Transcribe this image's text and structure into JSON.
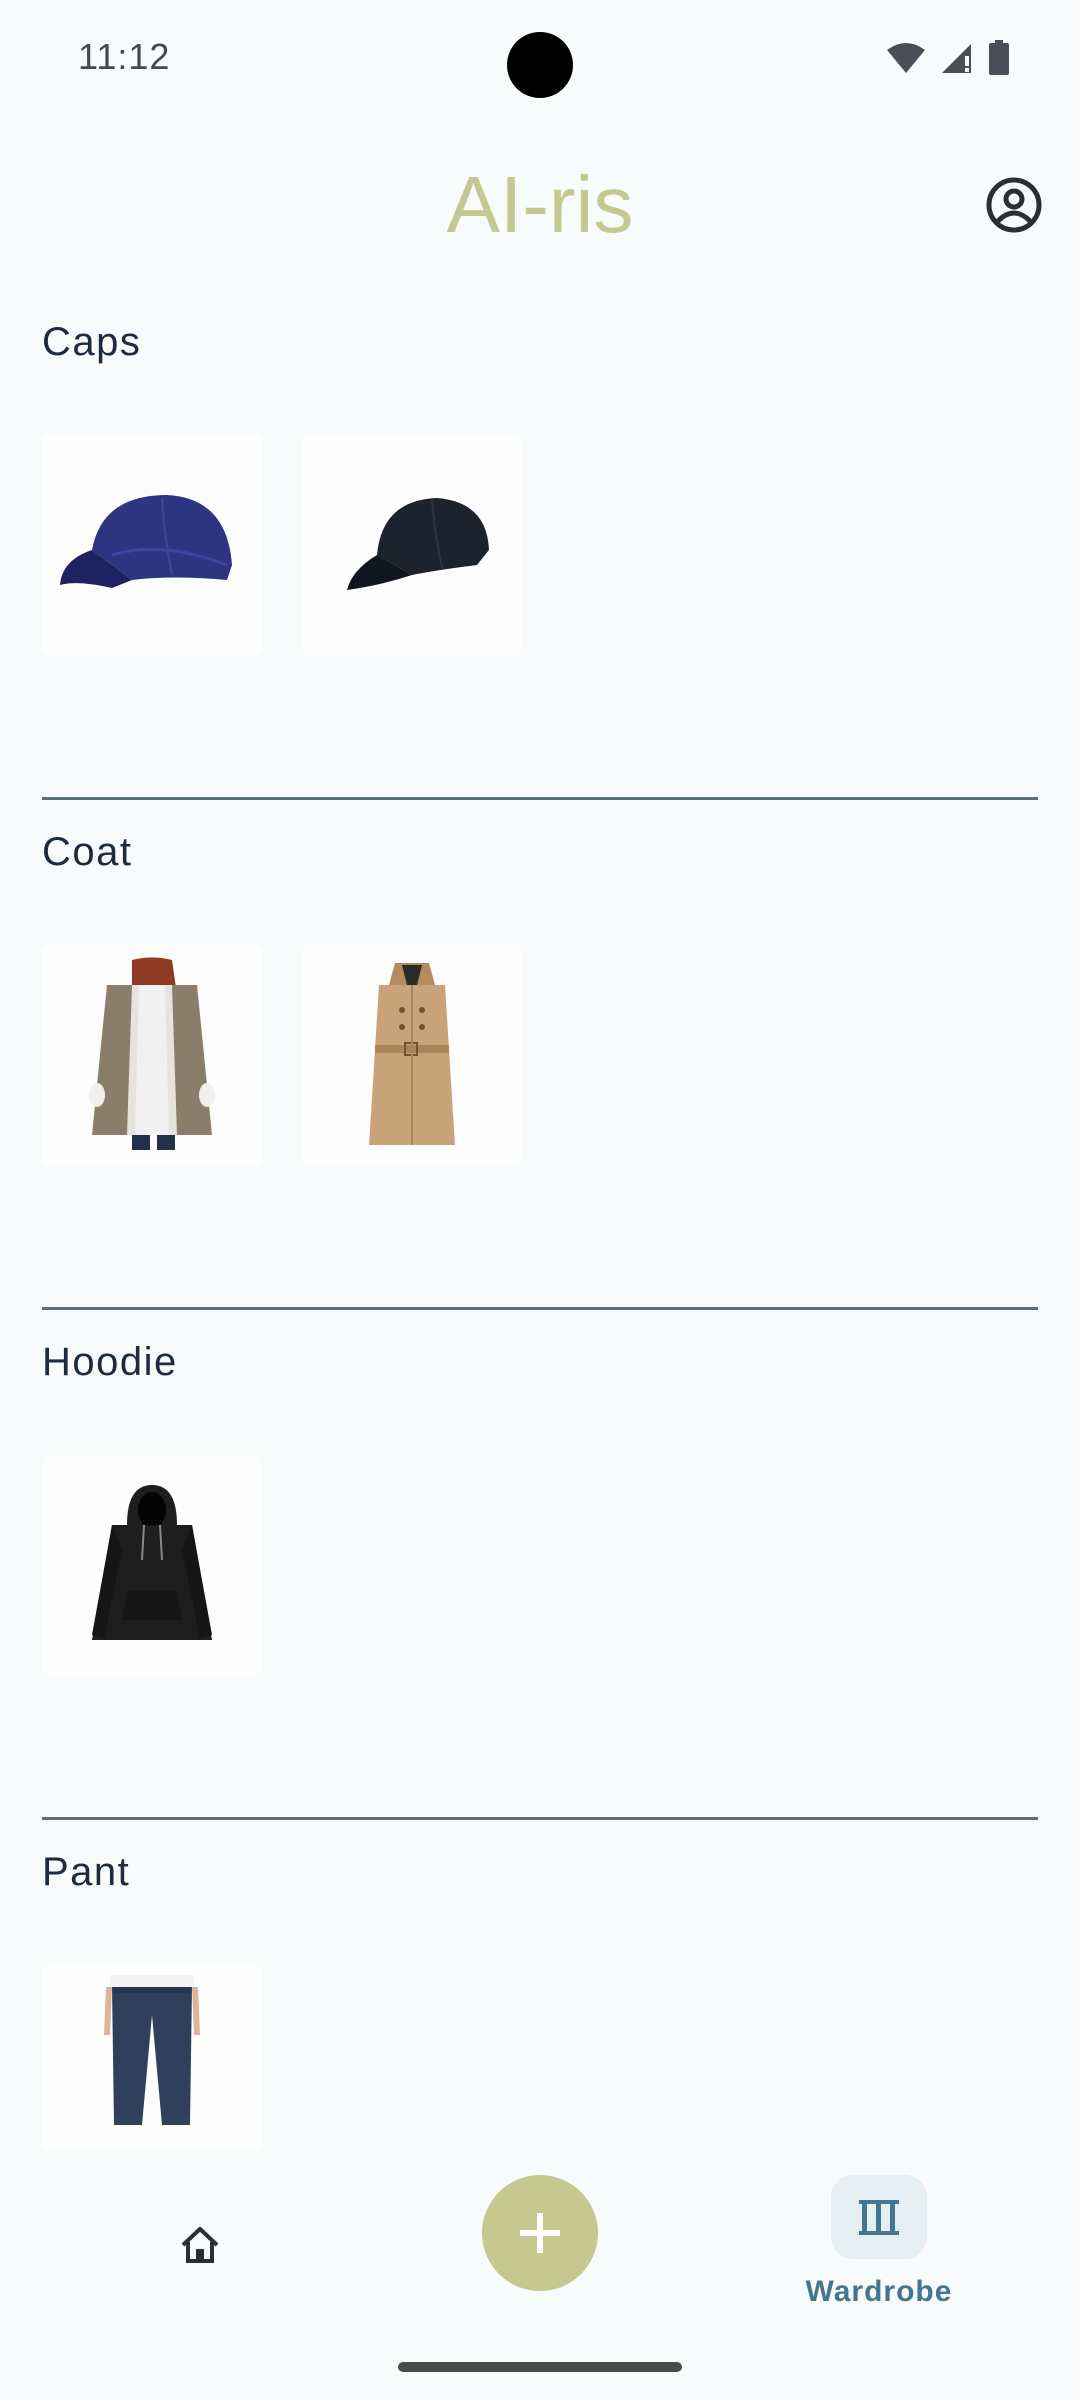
{
  "status_bar": {
    "time": "11:12",
    "icons": [
      "wifi-icon",
      "signal-icon",
      "battery-icon"
    ]
  },
  "app_bar": {
    "title": "AI-ris",
    "title_color": "#c5c98f",
    "profile_icon": "account-circle-icon"
  },
  "wardrobe": {
    "categories": [
      {
        "title": "Caps",
        "items": [
          "navy-cap-image",
          "black-cap-image"
        ]
      },
      {
        "title": "Coat",
        "items": [
          "shearling-coat-image",
          "trench-coat-image"
        ]
      },
      {
        "title": "Hoodie",
        "items": [
          "black-hoodie-image"
        ]
      },
      {
        "title": "Pant",
        "items": [
          "navy-pant-image"
        ]
      }
    ]
  },
  "bottom_nav": {
    "home_icon": "home-icon",
    "add_icon": "plus-icon",
    "add_button_color": "#c5c98f",
    "wardrobe_icon": "wardrobe-icon",
    "wardrobe_label": "Wardrobe",
    "active_tab_color": "#44778f"
  }
}
